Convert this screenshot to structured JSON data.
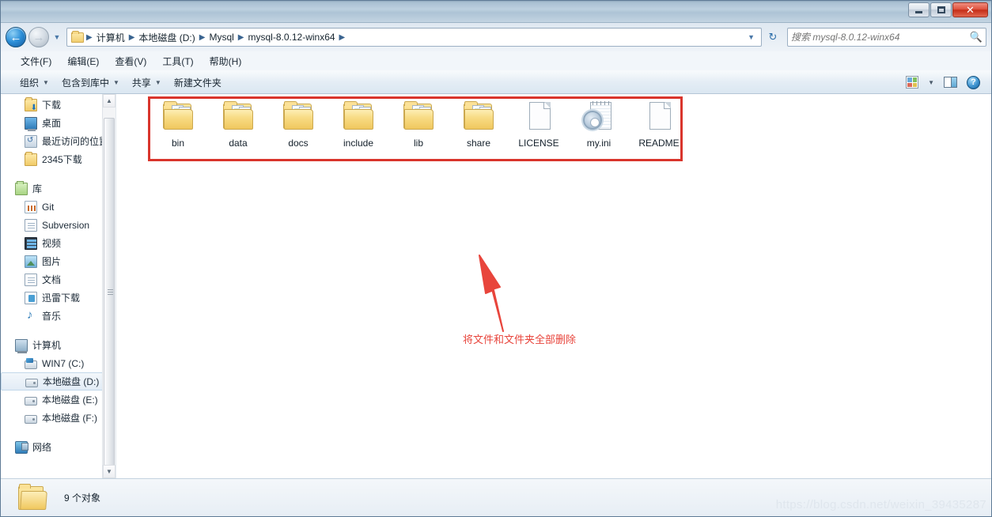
{
  "window": {
    "titlebar": {
      "title": ""
    },
    "buttons": {
      "minimize": "minimize-button",
      "maximize": "restore-button",
      "close": "✕"
    }
  },
  "addressbar": {
    "back_label": "←",
    "forward_label": "→",
    "history_caret": "▼",
    "crumbs": [
      "计算机",
      "本地磁盘 (D:)",
      "Mysql",
      "mysql-8.0.12-winx64"
    ],
    "separator": "▶",
    "dropdown_caret": "▼",
    "refresh_label": "↻"
  },
  "search": {
    "placeholder": "搜索 mysql-8.0.12-winx64",
    "value": "",
    "icon": "🔍"
  },
  "menubar": {
    "items": [
      {
        "label": "文件(F)"
      },
      {
        "label": "编辑(E)"
      },
      {
        "label": "查看(V)"
      },
      {
        "label": "工具(T)"
      },
      {
        "label": "帮助(H)"
      }
    ]
  },
  "commandbar": {
    "items": [
      {
        "label": "组织",
        "caret": "▼"
      },
      {
        "label": "包含到库中",
        "caret": "▼"
      },
      {
        "label": "共享",
        "caret": "▼"
      },
      {
        "label": "新建文件夹",
        "caret": ""
      }
    ],
    "view_caret": "▼",
    "help_label": "?"
  },
  "sidebar": {
    "items": [
      {
        "label": "下载",
        "icon": "folder-download-icon",
        "kind": "item"
      },
      {
        "label": "桌面",
        "icon": "desktop-icon",
        "kind": "item"
      },
      {
        "label": "最近访问的位置",
        "icon": "recent-places-icon",
        "kind": "item"
      },
      {
        "label": "2345下载",
        "icon": "folder-icon",
        "kind": "item"
      },
      {
        "label": "库",
        "icon": "library-icon",
        "kind": "group"
      },
      {
        "label": "Git",
        "icon": "git-icon",
        "kind": "item"
      },
      {
        "label": "Subversion",
        "icon": "document-icon",
        "kind": "item"
      },
      {
        "label": "视频",
        "icon": "video-icon",
        "kind": "item"
      },
      {
        "label": "图片",
        "icon": "pictures-icon",
        "kind": "item"
      },
      {
        "label": "文档",
        "icon": "documents-icon",
        "kind": "item"
      },
      {
        "label": "迅雷下载",
        "icon": "thunder-download-icon",
        "kind": "item"
      },
      {
        "label": "音乐",
        "icon": "music-icon",
        "kind": "item"
      },
      {
        "label": "计算机",
        "icon": "computer-icon",
        "kind": "group"
      },
      {
        "label": "WIN7 (C:)",
        "icon": "windows-drive-icon",
        "kind": "item"
      },
      {
        "label": "本地磁盘 (D:)",
        "icon": "hard-disk-icon",
        "kind": "item",
        "selected": true
      },
      {
        "label": "本地磁盘 (E:)",
        "icon": "hard-disk-icon",
        "kind": "item"
      },
      {
        "label": "本地磁盘 (F:)",
        "icon": "hard-disk-icon",
        "kind": "item"
      },
      {
        "label": "网络",
        "icon": "network-icon",
        "kind": "group"
      }
    ],
    "scroll_up": "▲",
    "scroll_down": "▼"
  },
  "files": {
    "items": [
      {
        "name": "bin",
        "type": "folder"
      },
      {
        "name": "data",
        "type": "folder"
      },
      {
        "name": "docs",
        "type": "folder"
      },
      {
        "name": "include",
        "type": "folder"
      },
      {
        "name": "lib",
        "type": "folder"
      },
      {
        "name": "share",
        "type": "folder"
      },
      {
        "name": "LICENSE",
        "type": "document"
      },
      {
        "name": "my.ini",
        "type": "ini"
      },
      {
        "name": "README",
        "type": "document"
      }
    ]
  },
  "annotation": {
    "text": "将文件和文件夹全部删除",
    "color": "#e8453c",
    "highlight_color": "#d9352c"
  },
  "statusbar": {
    "text": "9 个对象"
  },
  "watermark": {
    "text": "https://blog.csdn.net/weixin_39435287"
  }
}
